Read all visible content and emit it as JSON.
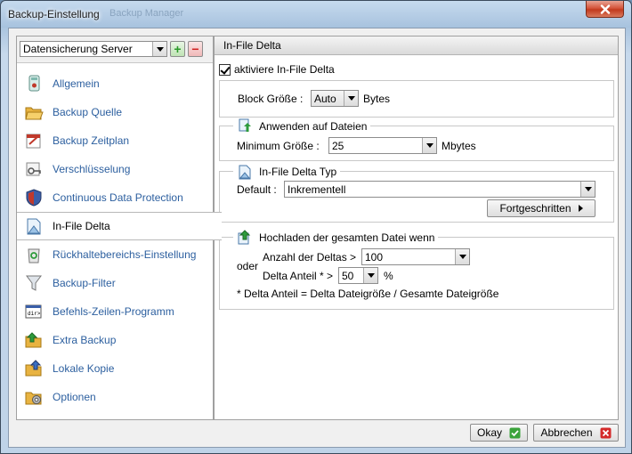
{
  "window": {
    "title": "Backup-Einstellung",
    "ghost_title": "Backup Manager"
  },
  "sidebar": {
    "server_select": "Datensicherung Server",
    "plus_label": "+",
    "minus_label": "−",
    "items": [
      {
        "label": "Allgemein",
        "icon": "general-icon"
      },
      {
        "label": "Backup Quelle",
        "icon": "folder-open-icon"
      },
      {
        "label": "Backup Zeitplan",
        "icon": "schedule-icon"
      },
      {
        "label": "Verschlüsselung",
        "icon": "key-icon"
      },
      {
        "label": "Continuous Data Protection",
        "icon": "shield-icon"
      },
      {
        "label": "In-File Delta",
        "icon": "document-icon"
      },
      {
        "label": "Rückhaltebereichs-Einstellung",
        "icon": "recycle-bin-icon"
      },
      {
        "label": "Backup-Filter",
        "icon": "funnel-icon"
      },
      {
        "label": "Befehls-Zeilen-Programm",
        "icon": "command-line-icon"
      },
      {
        "label": "Extra Backup",
        "icon": "extra-backup-icon"
      },
      {
        "label": "Lokale Kopie",
        "icon": "local-copy-icon"
      },
      {
        "label": "Optionen",
        "icon": "options-icon"
      }
    ]
  },
  "panel": {
    "header": "In-File Delta",
    "activate_label": "aktiviere  In-File Delta",
    "activate_checked": true,
    "block": {
      "label": "Block Größe :",
      "value": "Auto",
      "unit": "Bytes"
    },
    "apply": {
      "legend": "Anwenden auf Dateien",
      "min_label": "Minimum Größe :",
      "min_value": "25",
      "min_unit": "Mbytes"
    },
    "delta_type": {
      "legend": "In-File Delta Typ",
      "default_label": "Default :",
      "default_value": "Inkrementell",
      "advanced_button": "Fortgeschritten"
    },
    "upload": {
      "legend": "Hochladen der gesamten Datei wenn",
      "deltas_label": "Anzahl der Deltas >",
      "deltas_value": "100",
      "or_label": "oder",
      "share_label": "Delta Anteil * >",
      "share_value": "50",
      "share_unit": "%",
      "footnote": "* Delta Anteil = Delta Dateigröße / Gesamte Dateigröße"
    }
  },
  "footer": {
    "ok_label": "Okay",
    "cancel_label": "Abbrechen"
  },
  "colors": {
    "link_blue": "#2c5f9f",
    "ok_green": "#3aa33a",
    "cancel_red": "#d42a2a",
    "close_red": "#c23a1e"
  }
}
